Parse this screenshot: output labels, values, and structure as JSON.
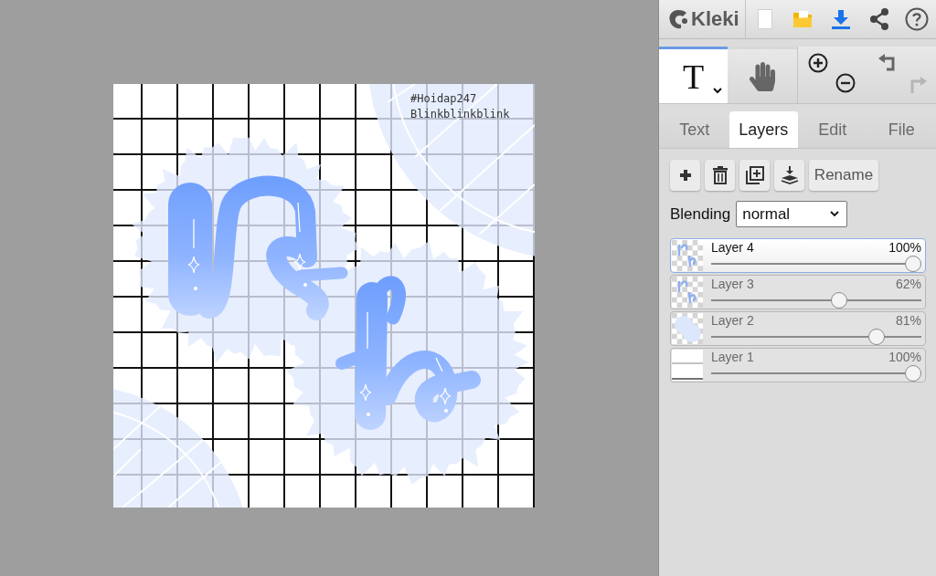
{
  "canvas": {
    "text_lines": [
      "#Hoidap247",
      "Blinkblinkblink"
    ]
  },
  "logo": {
    "text": "Kleki"
  },
  "tools": [
    {
      "kind": "text",
      "label": "T",
      "selected": true
    },
    {
      "kind": "hand",
      "selected": false
    }
  ],
  "history": {
    "undo": {
      "disabled": false
    },
    "redo": {
      "disabled": true
    }
  },
  "tabs": [
    {
      "label": "Text",
      "selected": false
    },
    {
      "label": "Layers",
      "selected": true
    },
    {
      "label": "Edit",
      "selected": false
    },
    {
      "label": "File",
      "selected": false
    }
  ],
  "layer_actions": {
    "rename_label": "Rename"
  },
  "blending": {
    "label": "Blending",
    "value": "normal"
  },
  "layers": [
    {
      "name": "Layer 4",
      "opacity": "100%",
      "level": 1,
      "selected": true,
      "thumbnail": {
        "kind": "letters"
      }
    },
    {
      "name": "Layer 3",
      "opacity": "62%",
      "level": 0.62,
      "selected": false,
      "thumbnail": {
        "kind": "letters"
      }
    },
    {
      "name": "Layer 2",
      "opacity": "81%",
      "level": 0.81,
      "selected": false,
      "thumbnail": {
        "kind": "blobs"
      }
    },
    {
      "name": "Layer 1",
      "opacity": "100%",
      "level": 1,
      "selected": false,
      "thumbnail": {
        "kind": "grid"
      }
    }
  ]
}
